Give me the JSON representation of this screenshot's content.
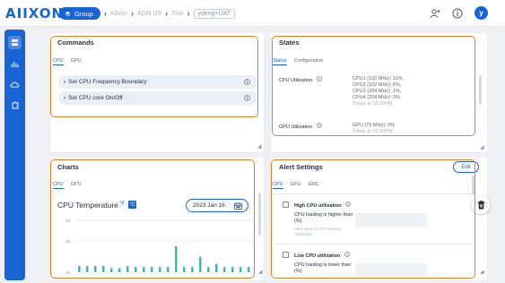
{
  "topbar": {
    "logo": "AIIXON",
    "group_pill": "Group",
    "breadcrumbs": [
      "Allxon",
      "ADM US",
      "Trial",
      "ydeng+UAT"
    ],
    "avatar_letter": "y"
  },
  "commands": {
    "title": "Commands",
    "tabs": [
      "CPU",
      "GPU"
    ],
    "items": [
      "Set CPU Frequency Boundary",
      "Set CPU core On/Off"
    ]
  },
  "states": {
    "title": "States",
    "tabs": [
      "Status",
      "Configuration"
    ],
    "cpu_label": "CPU Utilization",
    "cpu_lines": [
      "CPU1 (102 MHz): 11%,",
      "CPU2 (102 MHz): 6%,",
      "CPU3 (204 MHz): 1%,",
      "CPU4 (204 MHz): 3%"
    ],
    "cpu_time": "Today at 02:33PM",
    "gpu_label": "GPU Utilization",
    "gpu_line": "GPU (76 MHz): 0%",
    "gpu_time": "Today at 02:33PM"
  },
  "charts": {
    "title": "Charts",
    "tabs": [
      "CPU",
      "GPU"
    ],
    "heading": "CPU Temperature",
    "unit_f": "°F",
    "unit_c": "°C",
    "date": "2023 Jan 16"
  },
  "chart_data": {
    "type": "bar",
    "title": "CPU Temperature",
    "ylim": [
      25,
      30
    ],
    "y_ticks": [
      30,
      28,
      25
    ],
    "bar_color": "#2bb3a4",
    "values": [
      25.6,
      25.6,
      25.6,
      25.6,
      25.4,
      25.4,
      25.6,
      25.5,
      25.5,
      25.5,
      25.5,
      25.5,
      27.5,
      25.5,
      25.5,
      26.5,
      25.5,
      25.8,
      25.5,
      25.5,
      25.5,
      25.5
    ]
  },
  "alerts": {
    "title": "Alert Settings",
    "edit_label": "Edit",
    "tabs": [
      "CPU",
      "GPU",
      "EMC"
    ],
    "high_title": "High CPU utilization",
    "high_desc": "CPU loading is higher than (%)",
    "high_hint": "Alert when a CPU loading >30/100%",
    "low_title": "Low CPU utilization",
    "low_desc": "CPU loading is lower than (%)"
  },
  "colors": {
    "accent": "#1764d6",
    "highlight": "#e67e22",
    "bar": "#2bb3a4"
  }
}
